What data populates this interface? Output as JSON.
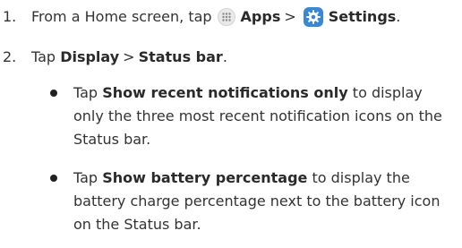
{
  "steps": [
    {
      "number": "1.",
      "text_before": "From a Home screen, tap",
      "apps_label": "Apps",
      "separator": ">",
      "settings_label": "Settings",
      "end": "."
    },
    {
      "number": "2.",
      "text_before": "Tap",
      "display_label": "Display",
      "separator": ">",
      "status_label": "Status bar",
      "end": "."
    }
  ],
  "bullets": [
    {
      "text_before": "Tap",
      "bold": "Show recent notifications only",
      "text_after": "to display only the three most recent notification icons on the Status bar."
    },
    {
      "text_before": "Tap",
      "bold": "Show battery percentage",
      "text_after": "to display the battery charge percentage next to the battery icon on the Status bar."
    }
  ],
  "icons": {
    "apps": "apps-grid-icon",
    "settings": "gear-icon"
  },
  "colors": {
    "settings_icon_bg": "#3b87d4",
    "text": "#333333"
  }
}
